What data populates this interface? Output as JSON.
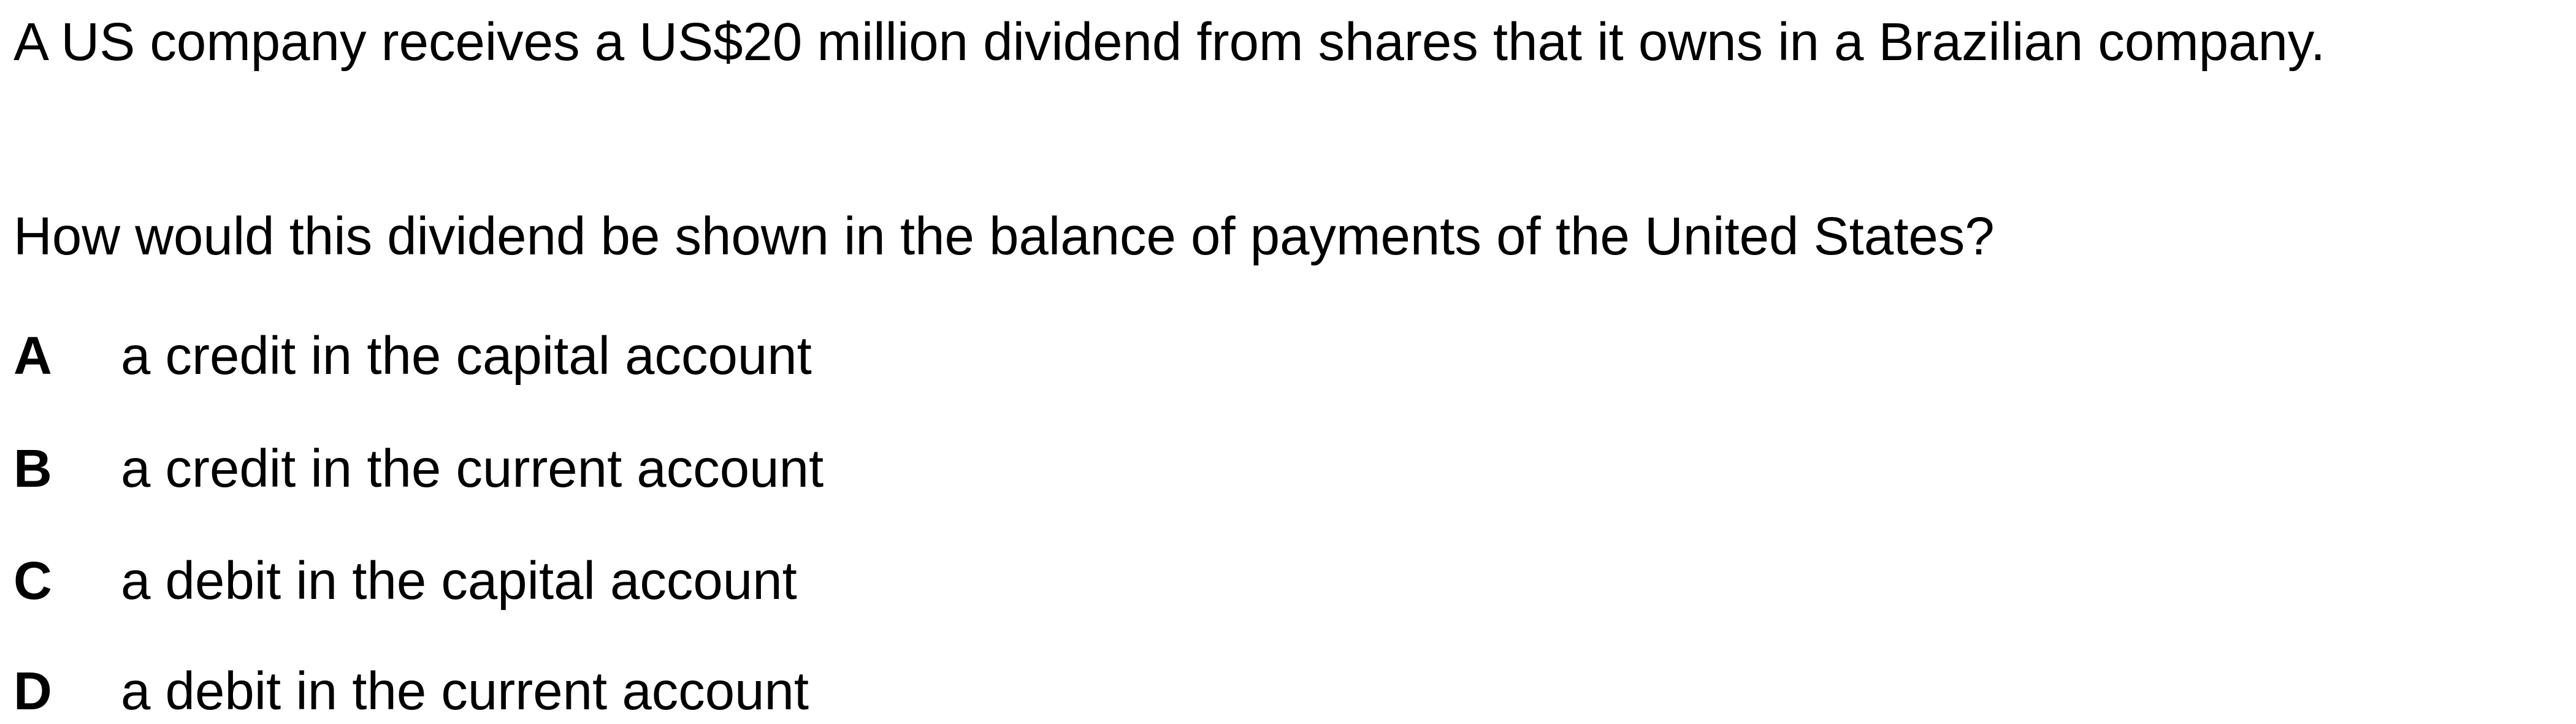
{
  "question": {
    "stem": "A US company receives a US$20 million dividend from shares that it owns in a Brazilian company.",
    "prompt": "How would this dividend be shown in the balance of payments of the United States?"
  },
  "options": [
    {
      "letter": "A",
      "text": "a credit in the capital account"
    },
    {
      "letter": "B",
      "text": "a credit in the current account"
    },
    {
      "letter": "C",
      "text": "a debit in the capital account"
    },
    {
      "letter": "D",
      "text": "a debit in the current account"
    }
  ]
}
